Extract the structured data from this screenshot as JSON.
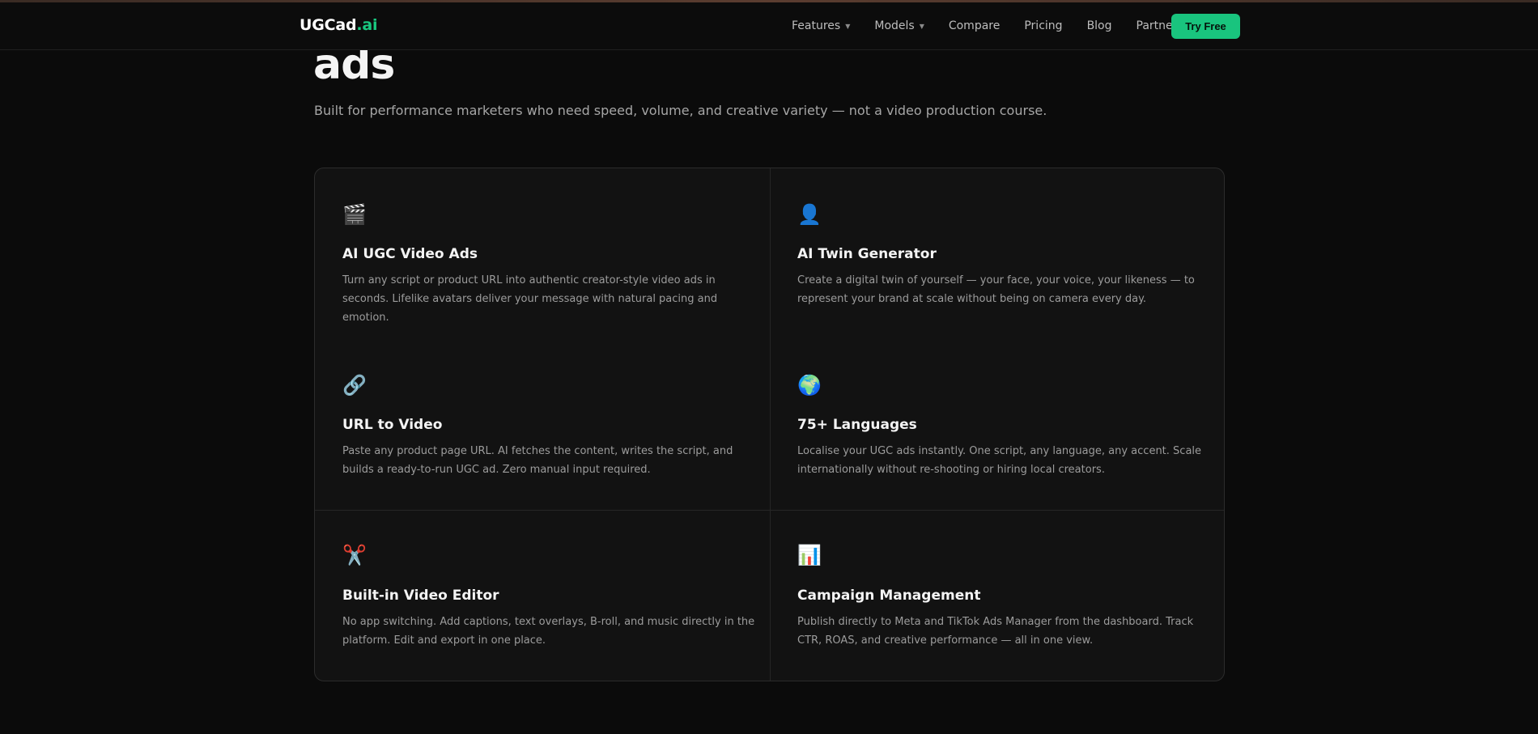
{
  "header": {
    "logo_main": "UGCad",
    "logo_accent": ".ai",
    "nav": {
      "features": "Features",
      "models": "Models",
      "compare": "Compare",
      "pricing": "Pricing",
      "blog": "Blog",
      "partner": "Partner"
    },
    "cta": "Try Free"
  },
  "hero": {
    "title_tail": "ads",
    "subtitle": "Built for performance marketers who need speed, volume, and creative variety — not a video production course."
  },
  "features": [
    {
      "icon": "clapperboard-icon",
      "glyph": "🎬",
      "title": "AI UGC Video Ads",
      "desc": "Turn any script or product URL into authentic creator-style video ads in seconds. Lifelike avatars deliver your message with natural pacing and emotion."
    },
    {
      "icon": "person-icon",
      "glyph": "👤",
      "title": "AI Twin Generator",
      "desc": "Create a digital twin of yourself — your face, your voice, your likeness — to represent your brand at scale without being on camera every day."
    },
    {
      "icon": "link-icon",
      "glyph": "🔗",
      "title": "URL to Video",
      "desc": "Paste any product page URL. AI fetches the content, writes the script, and builds a ready-to-run UGC ad. Zero manual input required."
    },
    {
      "icon": "globe-icon",
      "glyph": "🌍",
      "title": "75+ Languages",
      "desc": "Localise your UGC ads instantly. One script, any language, any accent. Scale internationally without re-shooting or hiring local creators."
    },
    {
      "icon": "scissors-icon",
      "glyph": "✂️",
      "title": "Built-in Video Editor",
      "desc": "No app switching. Add captions, text overlays, B-roll, and music directly in the platform. Edit and export in one place."
    },
    {
      "icon": "bar-chart-icon",
      "glyph": "📊",
      "title": "Campaign Management",
      "desc": "Publish directly to Meta and TikTok Ads Manager from the dashboard. Track CTR, ROAS, and creative performance — all in one view."
    }
  ],
  "colors": {
    "accent": "#19c47e",
    "background": "#0b0b0b",
    "card": "#121212"
  }
}
